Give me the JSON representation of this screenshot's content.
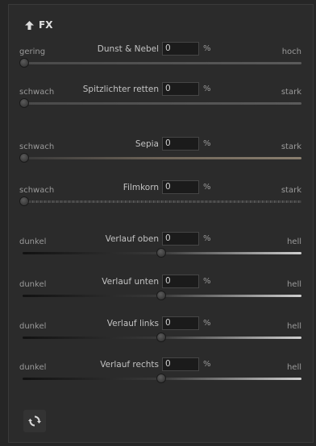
{
  "header": {
    "title": "FX",
    "icon": "arrow-up-icon"
  },
  "sliders": [
    {
      "id": "dunst",
      "name": "Dunst & Nebel",
      "value": "0",
      "unit": "%",
      "left": "gering",
      "right": "hoch"
    },
    {
      "id": "spitzlichter",
      "name": "Spitzlichter retten",
      "value": "0",
      "unit": "%",
      "left": "schwach",
      "right": "stark"
    },
    {
      "id": "sepia",
      "name": "Sepia",
      "value": "0",
      "unit": "%",
      "left": "schwach",
      "right": "stark"
    },
    {
      "id": "filmkorn",
      "name": "Filmkorn",
      "value": "0",
      "unit": "%",
      "left": "schwach",
      "right": "stark"
    },
    {
      "id": "verlauf-oben",
      "name": "Verlauf oben",
      "value": "0",
      "unit": "%",
      "left": "dunkel",
      "right": "hell"
    },
    {
      "id": "verlauf-unten",
      "name": "Verlauf unten",
      "value": "0",
      "unit": "%",
      "left": "dunkel",
      "right": "hell"
    },
    {
      "id": "verlauf-links",
      "name": "Verlauf links",
      "value": "0",
      "unit": "%",
      "left": "dunkel",
      "right": "hell"
    },
    {
      "id": "verlauf-rechts",
      "name": "Verlauf rechts",
      "value": "0",
      "unit": "%",
      "left": "dunkel",
      "right": "hell"
    }
  ],
  "footer": {
    "reset_icon": "reset-icon"
  }
}
